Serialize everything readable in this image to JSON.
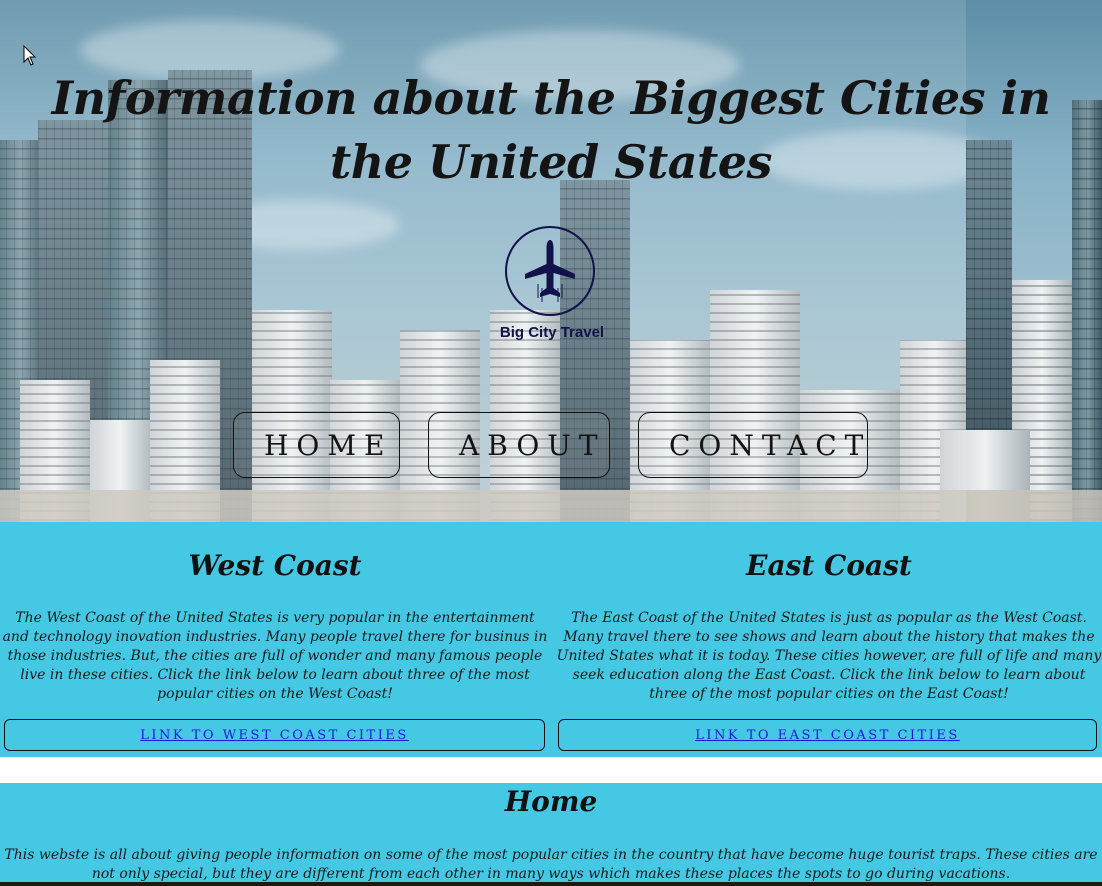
{
  "hero": {
    "title": "Information about the Biggest Cities in the United States",
    "logo_text": "Big City Travel",
    "nav": {
      "home": "HOME",
      "about": "ABOUT",
      "contact": "CONTACT"
    }
  },
  "west": {
    "heading": "West Coast",
    "text": "The West Coast of the United States is very popular in the entertainment and technology inovation industries. Many people travel there for businus in those industries. But, the cities are full of wonder and many famous people live in these cities. Click the link below to learn about three of the most popular cities on the West Coast!",
    "link": "LINK TO WEST COAST CITIES"
  },
  "east": {
    "heading": "East Coast",
    "text": "The East Coast of the United States is just as popular as the West Coast. Many travel there to see shows and learn about the history that makes the United States what it is today. These cities however, are full of life and many seek education along the East Coast. Click the link below to learn about three of the most popular cities on the East Coast!",
    "link": "LINK TO EAST COAST CITIES"
  },
  "home": {
    "heading": "Home",
    "text": "This webste is all about giving people information on some of the most popular cities in the country that have become huge tourist traps. These cities are not only special, but they are different from each other in many ways which makes these places the spots to go during vacations."
  },
  "colors": {
    "section_bg": "#45c8e3",
    "link": "#1a1adb",
    "logo": "#12124a"
  },
  "icons": [
    "airplane-icon",
    "mouse-cursor-icon"
  ]
}
